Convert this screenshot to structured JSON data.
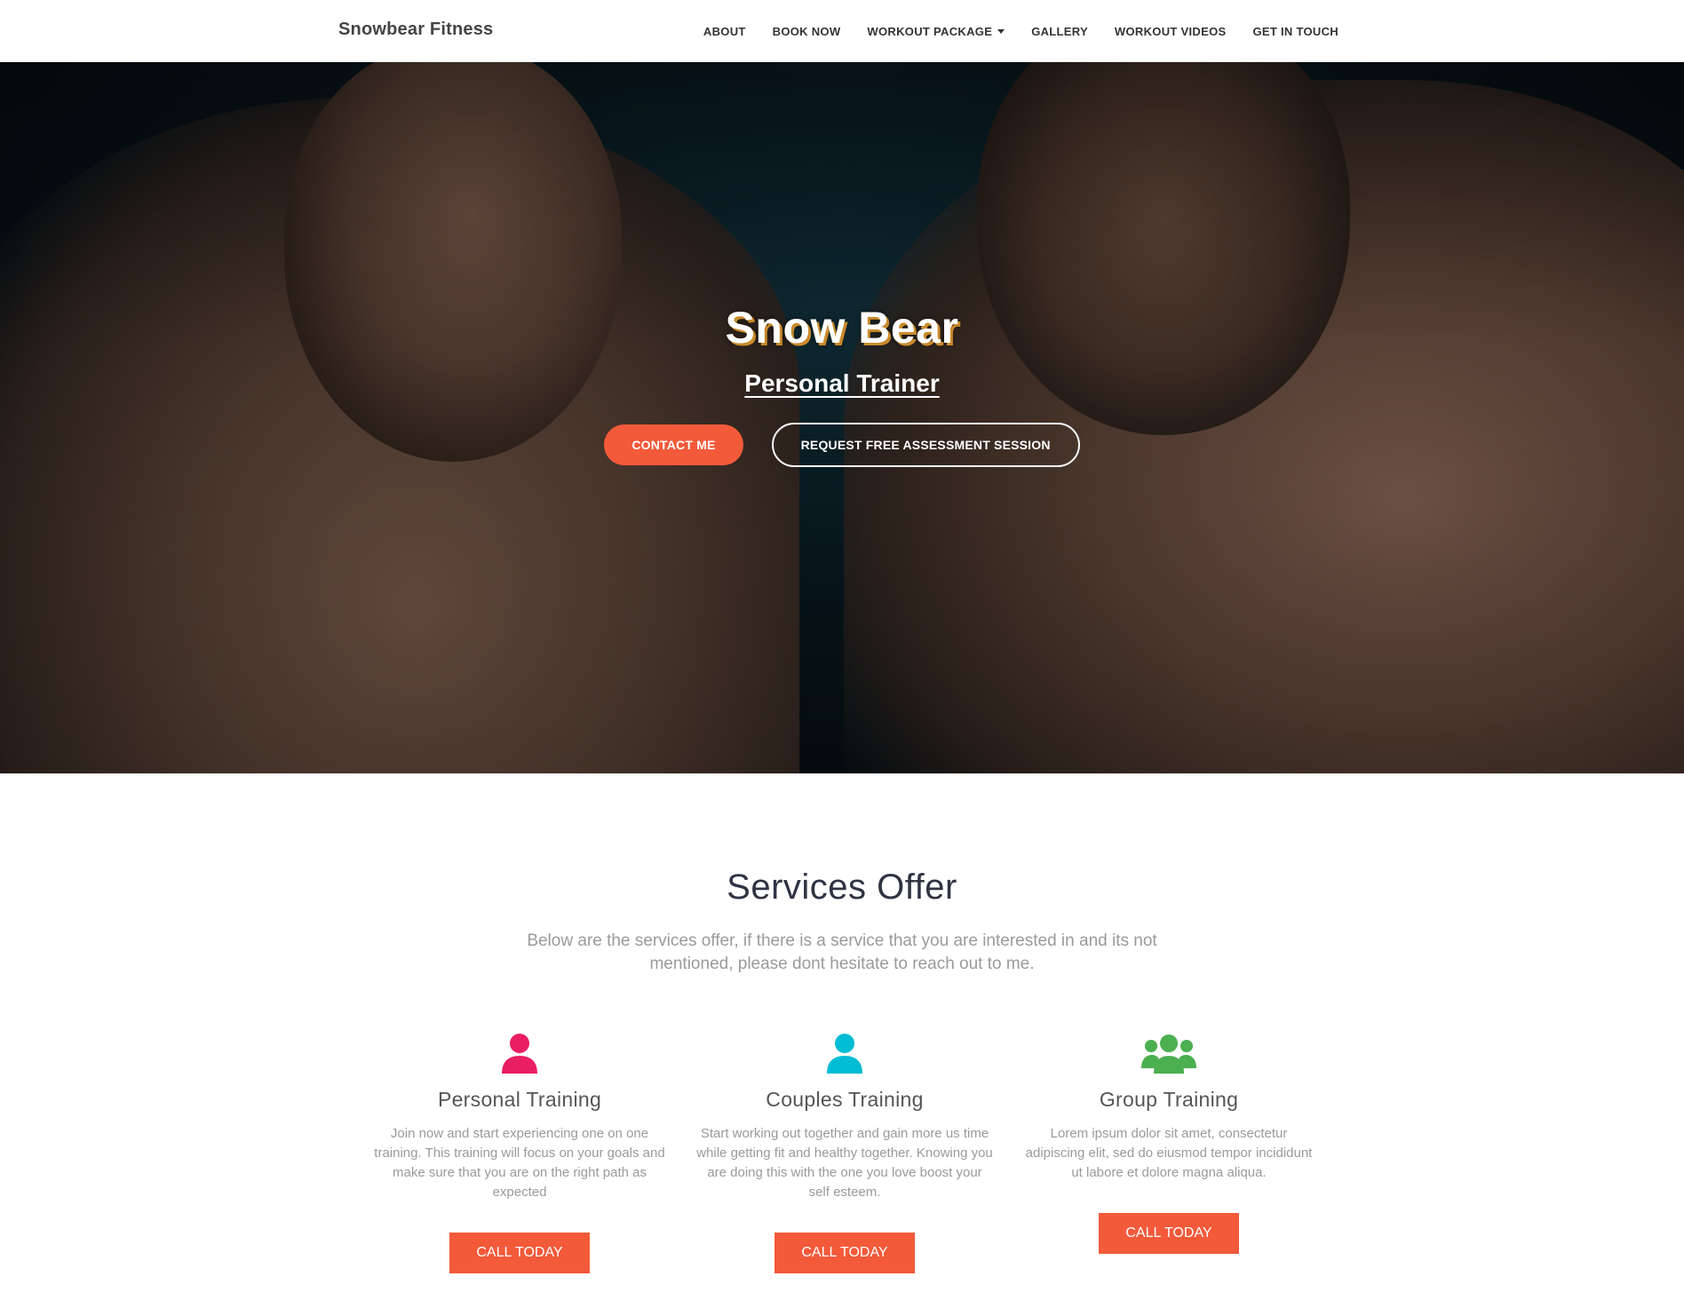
{
  "navbar": {
    "brand": "Snowbear Fitness",
    "links": [
      {
        "label": "ABOUT"
      },
      {
        "label": "BOOK NOW"
      },
      {
        "label": "WORKOUT PACKAGE",
        "dropdown": true
      },
      {
        "label": "GALLERY"
      },
      {
        "label": "WORKOUT VIDEOS"
      },
      {
        "label": "GET IN TOUCH"
      }
    ]
  },
  "hero": {
    "title": "Snow Bear",
    "subtitle": "Personal Trainer",
    "primary_button": "CONTACT ME",
    "secondary_button": "REQUEST FREE ASSESSMENT SESSION"
  },
  "services": {
    "title": "Services Offer",
    "description": "Below are the services offer, if there is a service that you are interested in and its not mentioned, please dont hesitate to reach out to me.",
    "items": [
      {
        "icon": "user-icon",
        "icon_color": "#e91e63",
        "name": "Personal Training",
        "text": "Join now and start experiencing one on one training. This training will focus on your goals and make sure that you are on the right path as expected",
        "button": "CALL TODAY"
      },
      {
        "icon": "user-icon",
        "icon_color": "#00bcd4",
        "name": "Couples Training",
        "text": "Start working out together and gain more us time while getting fit and healthy together. Knowing you are doing this with the one you love boost your self esteem.",
        "button": "CALL TODAY"
      },
      {
        "icon": "users-group-icon",
        "icon_color": "#4caf50",
        "name": "Group Training",
        "text": "Lorem ipsum dolor sit amet, consectetur adipiscing elit, sed do eiusmod tempor incididunt ut labore et dolore magna aliqua.",
        "button": "CALL TODAY"
      }
    ]
  },
  "colors": {
    "accent": "#f25a3a",
    "heading": "#2f3342",
    "muted_text": "#9a9a9a"
  }
}
